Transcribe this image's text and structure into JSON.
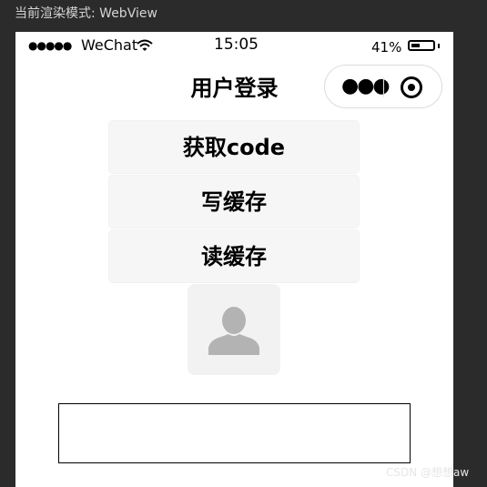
{
  "devtools": {
    "render_mode_label": "当前渲染模式: WebView"
  },
  "status_bar": {
    "signal": "●●●●●",
    "carrier": "WeChat",
    "wifi_icon": "wifi-icon",
    "time": "15:05",
    "battery_percent": "41%",
    "battery_level": 0.41
  },
  "nav": {
    "title": "用户登录",
    "capsule_more_icon": "more-dots-icon",
    "capsule_close_icon": "target-icon"
  },
  "buttons": {
    "get_code": "获取code",
    "write_cache": "写缓存",
    "read_cache": "读缓存"
  },
  "avatar": {
    "icon": "person-avatar-icon",
    "color": "#b3b3b3"
  },
  "input": {
    "value": ""
  },
  "watermark": "CSDN @想想aw"
}
